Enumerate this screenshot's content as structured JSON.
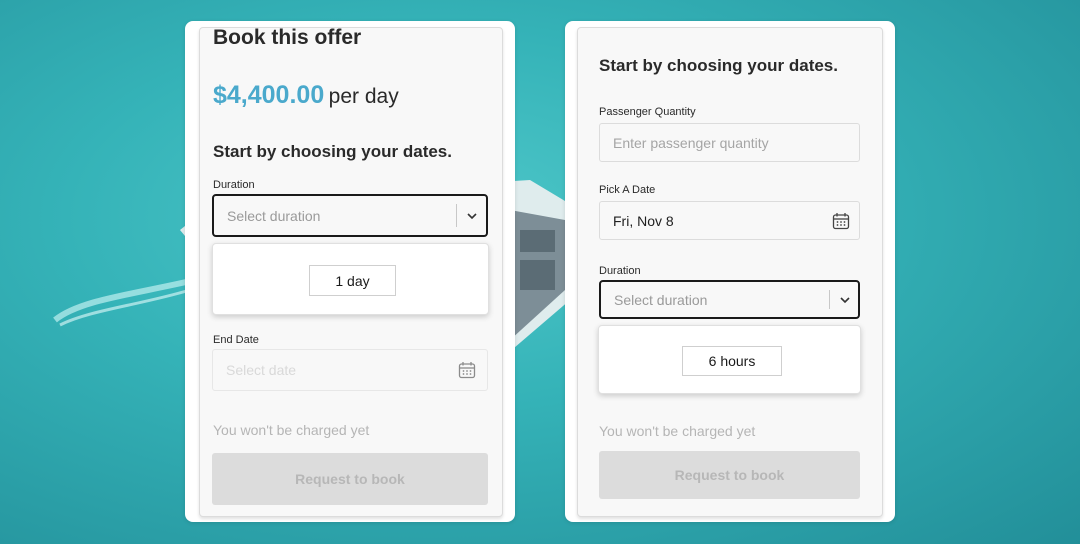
{
  "left_card": {
    "title": "Book this offer",
    "price": "$4,400.00",
    "price_unit": "per day",
    "heading": "Start by choosing your dates.",
    "duration_label": "Duration",
    "duration_placeholder": "Select duration",
    "duration_option": "1 day",
    "end_date_label": "End Date",
    "end_date_placeholder": "Select date",
    "note": "You won't be charged yet",
    "button": "Request to book"
  },
  "right_card": {
    "heading": "Start by choosing your dates.",
    "passenger_label": "Passenger Quantity",
    "passenger_placeholder": "Enter passenger quantity",
    "date_label": "Pick A Date",
    "date_value": "Fri, Nov 8",
    "duration_label": "Duration",
    "duration_placeholder": "Select duration",
    "duration_option": "6 hours",
    "note": "You won't be charged yet",
    "button": "Request to book"
  },
  "colors": {
    "accent_price": "#4aa9cc",
    "water": "#35b3b8",
    "button_disabled": "#dcdcdc"
  },
  "icons": [
    "chevron-down-icon",
    "calendar-icon"
  ]
}
